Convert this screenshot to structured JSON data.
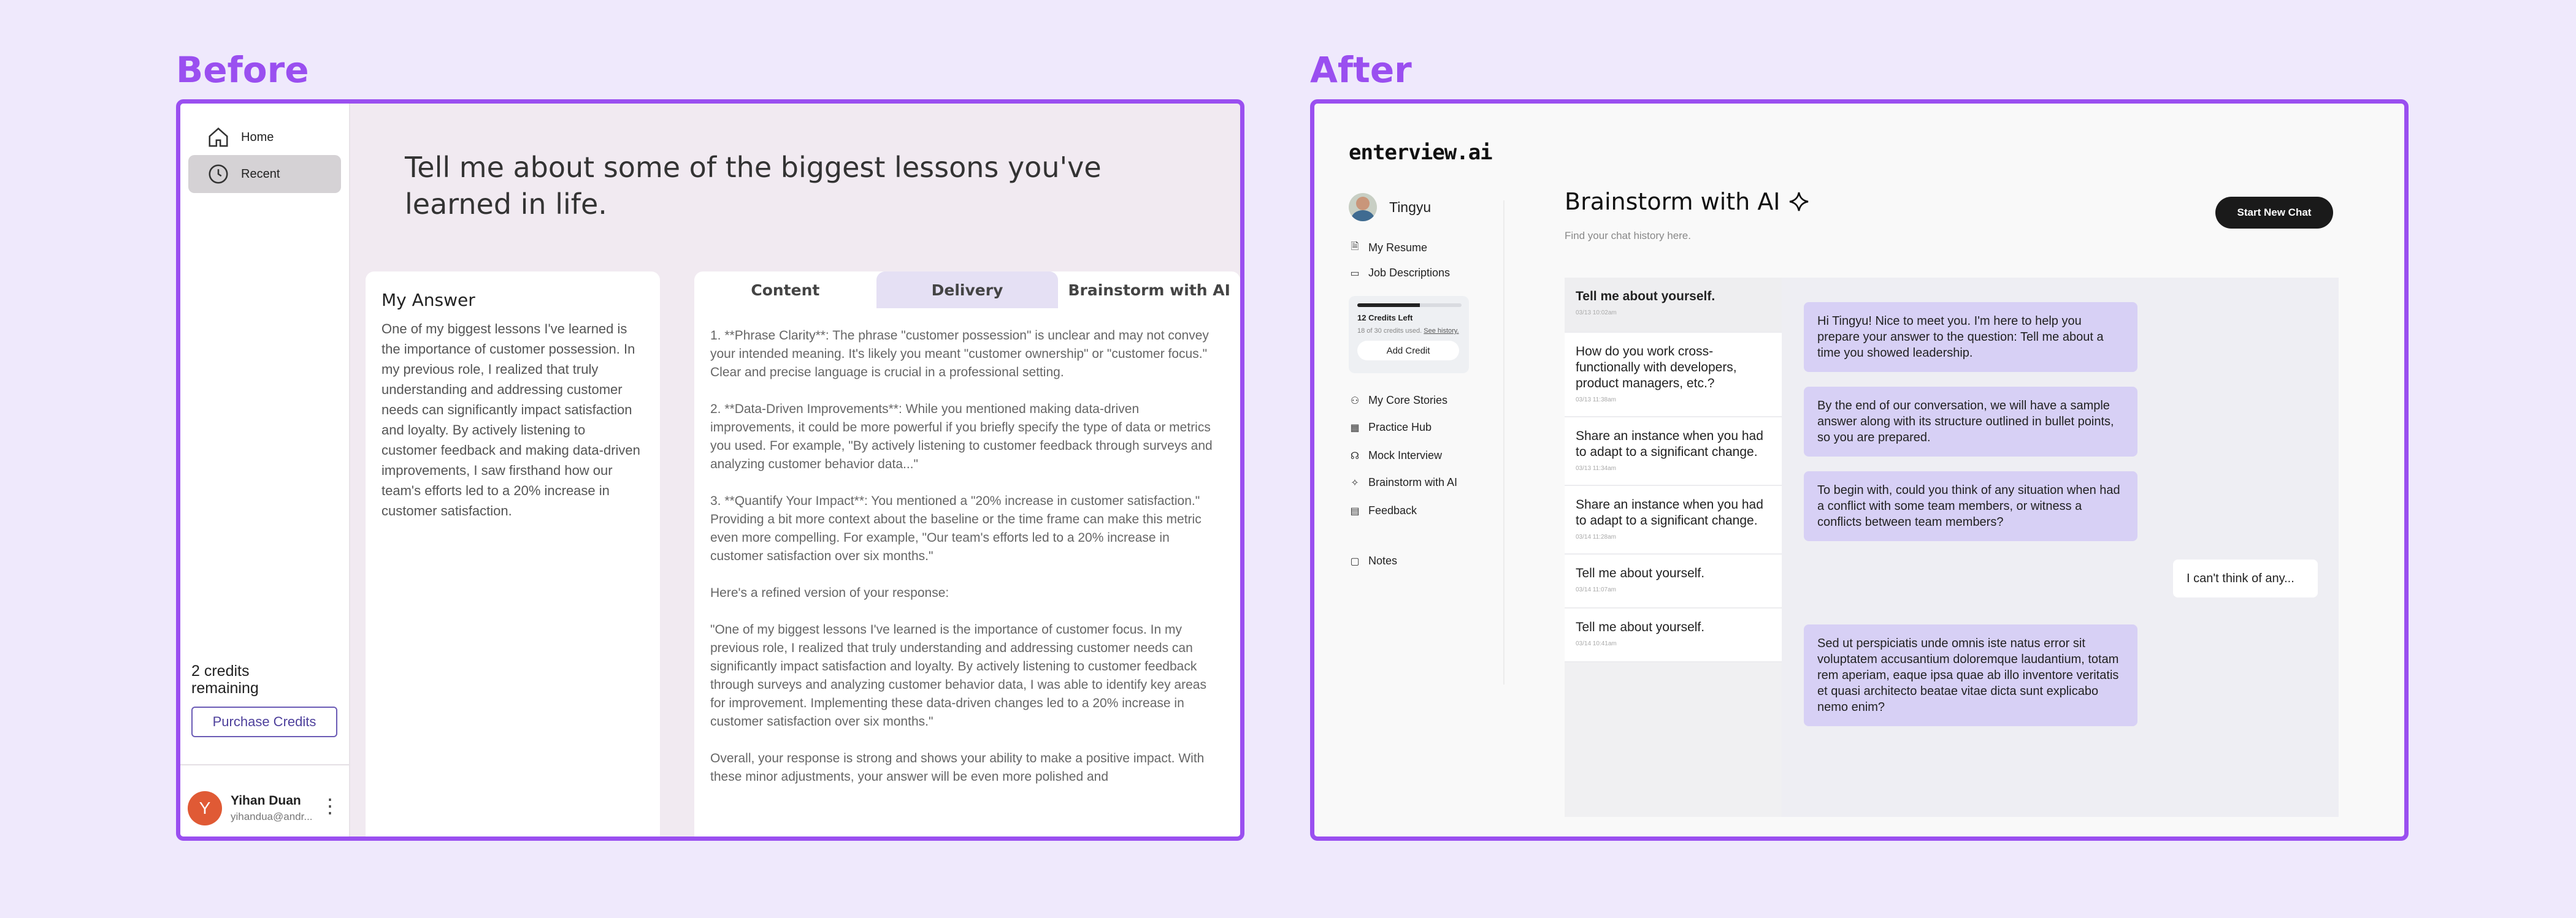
{
  "labels": {
    "before": "Before",
    "after": "After"
  },
  "before": {
    "sidebar": {
      "home": "Home",
      "recent": "Recent",
      "credits": "2 credits remaining",
      "purchase": "Purchase Credits",
      "user_initial": "Y",
      "user_name": "Yihan Duan",
      "user_email": "yihandua@andr..."
    },
    "question": "Tell me about some of the biggest lessons you've learned in life.",
    "answer": {
      "title": "My Answer",
      "text": "One of my biggest lessons I've learned is the importance of customer possession. In my previous role, I realized that truly understanding and addressing customer needs can significantly impact satisfaction and loyalty. By actively listening to customer feedback and making data-driven improvements, I saw firsthand how our team's efforts led to a 20% increase in customer satisfaction."
    },
    "tabs": [
      "Content",
      "Delivery",
      "Brainstorm with AI"
    ],
    "feedback": [
      "1. **Phrase Clarity**: The phrase \"customer possession\" is unclear and may not convey your intended meaning. It's likely you meant \"customer ownership\" or \"customer focus.\" Clear and precise language is crucial in a professional setting.",
      "2. **Data-Driven Improvements**: While you mentioned making data-driven improvements, it could be more powerful if you briefly specify the type of data or metrics you used. For example, \"By actively listening to customer feedback through surveys and analyzing customer behavior data...\"",
      "3. **Quantify Your Impact**: You mentioned a \"20% increase in customer satisfaction.\" Providing a bit more context about the baseline or the time frame can make this metric even more compelling. For example, \"Our team's efforts led to a 20% increase in customer satisfaction over six months.\"",
      "Here's a refined version of your response:",
      "\"One of my biggest lessons I've learned is the importance of customer focus. In my previous role, I realized that truly understanding and addressing customer needs can significantly impact satisfaction and loyalty. By actively listening to customer feedback through surveys and analyzing customer behavior data, I was able to identify key areas for improvement. Implementing these data-driven changes led to a 20% increase in customer satisfaction over six months.\"",
      "Overall, your response is strong and shows your ability to make a positive impact. With these minor adjustments, your answer will be even more polished and"
    ]
  },
  "after": {
    "logo": "enterview.ai",
    "user": "Tingyu",
    "nav_top": [
      {
        "label": "My Resume",
        "icon": "document-icon"
      },
      {
        "label": "Job Descriptions",
        "icon": "briefcase-icon"
      }
    ],
    "credit": {
      "title": "12 Credits Left",
      "sub_prefix": "18 of 30 credits used.",
      "sub_link": "See history.",
      "button": "Add Credit",
      "used_fraction": 0.6
    },
    "nav_bottom": [
      {
        "label": "My Core Stories",
        "icon": "person-icon"
      },
      {
        "label": "Practice Hub",
        "icon": "grid-icon"
      },
      {
        "label": "Mock Interview",
        "icon": "headset-icon"
      },
      {
        "label": "Brainstorm with AI",
        "icon": "sparkle-icon"
      },
      {
        "label": "Feedback",
        "icon": "chart-icon"
      }
    ],
    "notes": {
      "label": "Notes",
      "icon": "notes-icon"
    },
    "title": "Brainstorm with AI",
    "subtitle": "Find your chat history here.",
    "new_chat": "Start New Chat",
    "history": [
      {
        "title": "Tell me about yourself.",
        "date": "03/13 10:02am"
      },
      {
        "title": "How do you work cross-functionally with developers, product managers, etc.?",
        "date": "03/13 11:38am"
      },
      {
        "title": "Share an instance when you had to adapt to a significant change.",
        "date": "03/13 11:34am"
      },
      {
        "title": "Share an instance when you had to adapt to a significant change.",
        "date": "03/14 11:28am"
      },
      {
        "title": "Tell me about yourself.",
        "date": "03/14 11:07am"
      },
      {
        "title": "Tell me about yourself.",
        "date": "03/14 10:41am"
      }
    ],
    "messages": [
      {
        "from": "ai",
        "text": "Hi Tingyu! Nice to meet you. I'm here to help you prepare your answer to the question: Tell me about a time you showed leadership."
      },
      {
        "from": "ai",
        "text": "By the end of our conversation, we will have a sample answer along with its structure outlined in bullet points, so you are prepared."
      },
      {
        "from": "ai",
        "text": "To begin with, could you think of any situation when had a conflict with some team members, or witness a conflicts between team members?"
      },
      {
        "from": "user",
        "text": "I can't think of any..."
      },
      {
        "from": "ai",
        "text": "Sed ut perspiciatis unde omnis iste natus error sit voluptatem accusantium doloremque laudantium, totam rem aperiam, eaque ipsa quae ab illo inventore veritatis et quasi architecto beatae vitae dicta sunt explicabo nemo enim?"
      }
    ]
  },
  "colors": {
    "accent": "#9a4ff0",
    "bubble": "#d7d0f5"
  }
}
